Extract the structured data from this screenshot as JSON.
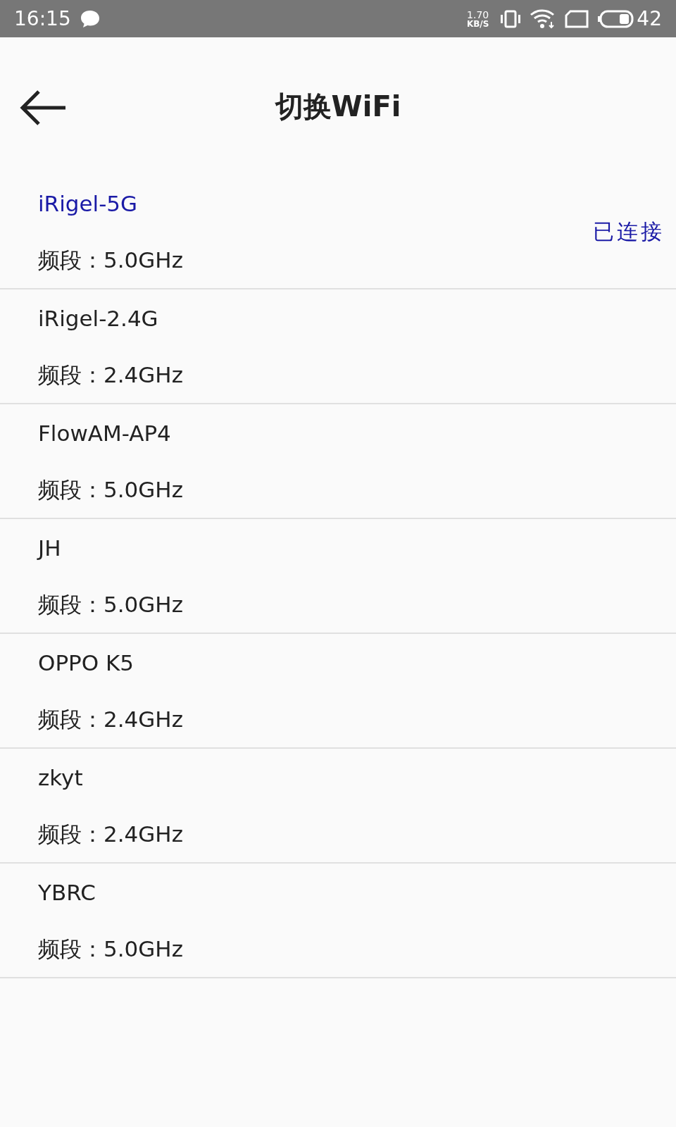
{
  "status_bar": {
    "time": "16:15",
    "speed_value": "1.70",
    "speed_unit": "KB/S",
    "battery": "42"
  },
  "header": {
    "title": "切换WiFi"
  },
  "networks": [
    {
      "name": "iRigel-5G",
      "band": "频段：5.0GHz",
      "connected": true,
      "status": "已连接"
    },
    {
      "name": "iRigel-2.4G",
      "band": "频段：2.4GHz",
      "connected": false
    },
    {
      "name": "FlowAM-AP4",
      "band": "频段：5.0GHz",
      "connected": false
    },
    {
      "name": "JH",
      "band": "频段：5.0GHz",
      "connected": false
    },
    {
      "name": "OPPO K5",
      "band": "频段：2.4GHz",
      "connected": false
    },
    {
      "name": "zkyt",
      "band": "频段：2.4GHz",
      "connected": false
    },
    {
      "name": "YBRC",
      "band": "频段：5.0GHz",
      "connected": false
    }
  ]
}
